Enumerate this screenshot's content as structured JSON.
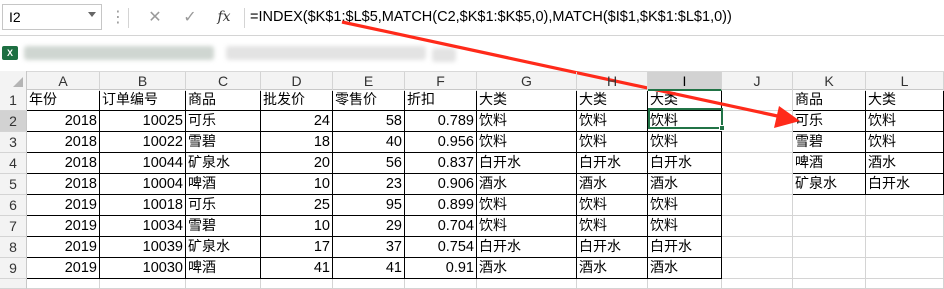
{
  "formula_bar": {
    "name_box": "I2",
    "menu_icon": "vertical-dots-icon",
    "cancel_icon": "x-icon",
    "enter_icon": "checkmark-icon",
    "fx_label": "fx",
    "formula": "=INDEX($K$1:$L$5,MATCH(C2,$K$1:$K$5,0),MATCH($I$1,$K$1:$L$1,0))"
  },
  "app_icon": "excel-icon",
  "columns": [
    "A",
    "B",
    "C",
    "D",
    "E",
    "F",
    "G",
    "H",
    "I",
    "J",
    "K",
    "L"
  ],
  "selected_column": "I",
  "rows": [
    "1",
    "2",
    "3",
    "4",
    "5",
    "6",
    "7",
    "8",
    "9"
  ],
  "selected_row": "2",
  "headers": [
    "年份",
    "订单编号",
    "商品",
    "批发价",
    "零售价",
    "折扣",
    "大类",
    "大类",
    "大类"
  ],
  "data": [
    [
      "2018",
      "10025",
      "可乐",
      "24",
      "58",
      "0.789",
      "饮料",
      "饮料",
      "饮料"
    ],
    [
      "2018",
      "10022",
      "雪碧",
      "18",
      "40",
      "0.956",
      "饮料",
      "饮料",
      "饮料"
    ],
    [
      "2018",
      "10044",
      "矿泉水",
      "20",
      "56",
      "0.837",
      "白开水",
      "白开水",
      "白开水"
    ],
    [
      "2018",
      "10004",
      "啤酒",
      "10",
      "23",
      "0.906",
      "酒水",
      "酒水",
      "酒水"
    ],
    [
      "2019",
      "10018",
      "可乐",
      "25",
      "95",
      "0.899",
      "饮料",
      "饮料",
      "饮料"
    ],
    [
      "2019",
      "10034",
      "雪碧",
      "10",
      "29",
      "0.704",
      "饮料",
      "饮料",
      "饮料"
    ],
    [
      "2019",
      "10039",
      "矿泉水",
      "17",
      "37",
      "0.754",
      "白开水",
      "白开水",
      "白开水"
    ],
    [
      "2019",
      "10030",
      "啤酒",
      "41",
      "41",
      "0.91",
      "酒水",
      "酒水",
      "酒水"
    ]
  ],
  "lookup_table": {
    "header": [
      "商品",
      "大类"
    ],
    "rows": [
      [
        "可乐",
        "饮料"
      ],
      [
        "雪碧",
        "饮料"
      ],
      [
        "啤酒",
        "酒水"
      ],
      [
        "矿泉水",
        "白开水"
      ]
    ]
  },
  "annotation_arrow_color": "#ff2a1a",
  "accent_color": "#217346"
}
